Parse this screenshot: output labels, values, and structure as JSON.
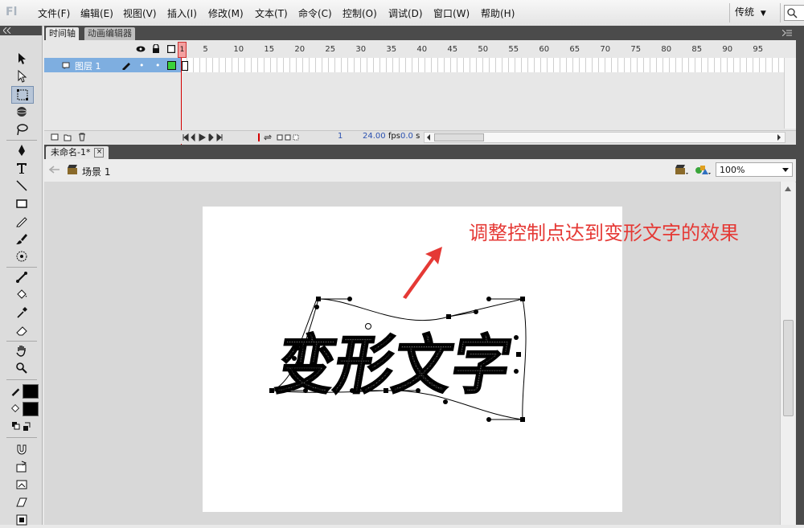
{
  "app": {
    "logo": "Fl"
  },
  "menu": {
    "items": [
      "文件(F)",
      "编辑(E)",
      "视图(V)",
      "插入(I)",
      "修改(M)",
      "文本(T)",
      "命令(C)",
      "控制(O)",
      "调试(D)",
      "窗口(W)",
      "帮助(H)"
    ],
    "workspace": "传统",
    "workspace_caret": "▼"
  },
  "timeline": {
    "tabs": [
      "时间轴",
      "动画编辑器"
    ],
    "header_icons": [
      "eye-icon",
      "lock-icon",
      "outline-icon"
    ],
    "ruler": [
      "1",
      "5",
      "10",
      "15",
      "20",
      "25",
      "30",
      "35",
      "40",
      "45",
      "50",
      "55",
      "60",
      "65",
      "70",
      "75",
      "80",
      "85",
      "90",
      "95"
    ],
    "layer_name": "图层 1",
    "current_frame": "1",
    "fps": "24.00",
    "fps_unit": "fps",
    "time": "0.0",
    "time_unit": "s"
  },
  "document": {
    "tab_title": "未命名-1*",
    "close_glyph": "×",
    "scene": "场景 1",
    "zoom": "100%"
  },
  "stage": {
    "annotation": "调整控制点达到变形文字的效果",
    "distorted_text": "变形文字",
    "annotation_color": "#e53935"
  }
}
